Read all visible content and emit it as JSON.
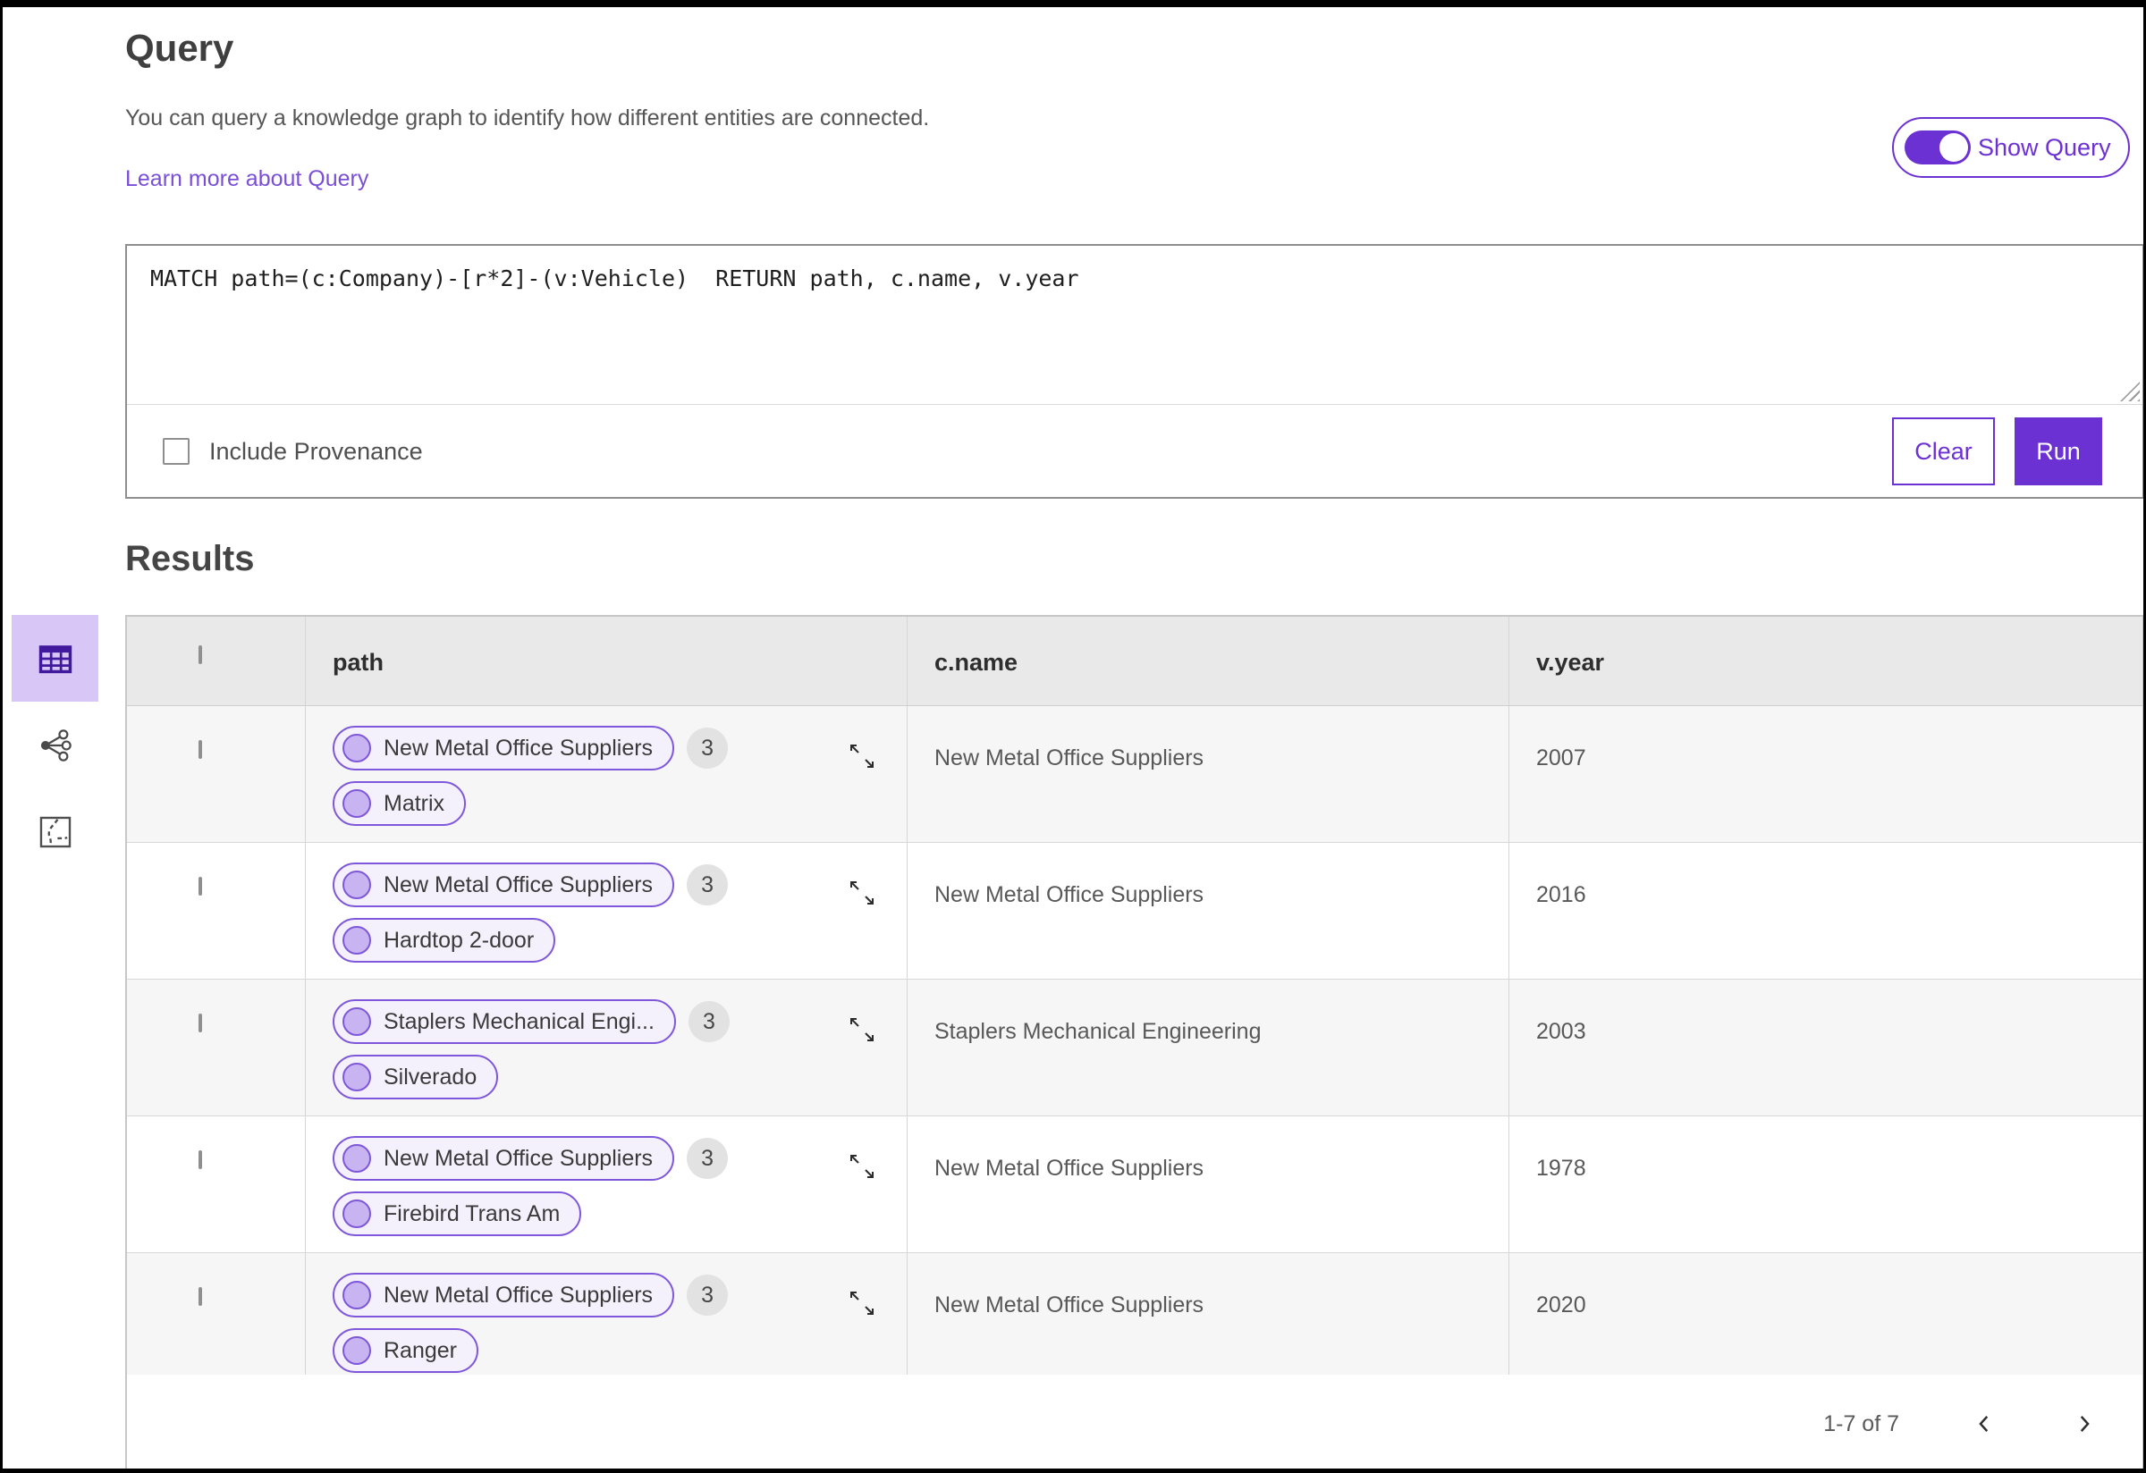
{
  "header": {
    "title": "Query",
    "description": "You can query a knowledge graph to identify how different entities are connected.",
    "learn_more_link": "Learn more about Query",
    "show_query_label": "Show Query"
  },
  "query_panel": {
    "query_text": "MATCH path=(c:Company)-[r*2]-(v:Vehicle)  RETURN path, c.name, v.year",
    "include_provenance_label": "Include Provenance",
    "clear_button": "Clear",
    "run_button": "Run"
  },
  "results": {
    "title": "Results",
    "views": [
      "table-view",
      "graph-view",
      "map-view"
    ],
    "selected_view": "table-view"
  },
  "table": {
    "columns": [
      "path",
      "c.name",
      "v.year"
    ],
    "rows": [
      {
        "path_start": "New Metal Office Suppliers",
        "count": "3",
        "path_end": "Matrix",
        "c_name": "New Metal Office Suppliers",
        "v_year": "2007"
      },
      {
        "path_start": "New Metal Office Suppliers",
        "count": "3",
        "path_end": "Hardtop 2-door",
        "c_name": "New Metal Office Suppliers",
        "v_year": "2016"
      },
      {
        "path_start": "Staplers Mechanical Engi...",
        "count": "3",
        "path_end": "Silverado",
        "c_name": "Staplers Mechanical Engineering",
        "v_year": "2003"
      },
      {
        "path_start": "New Metal Office Suppliers",
        "count": "3",
        "path_end": "Firebird Trans Am",
        "c_name": "New Metal Office Suppliers",
        "v_year": "1978"
      },
      {
        "path_start": "New Metal Office Suppliers",
        "count": "3",
        "path_end": "Ranger",
        "c_name": "New Metal Office Suppliers",
        "v_year": "2020"
      }
    ],
    "pagination": {
      "range": "1-7 of 7"
    }
  },
  "colors": {
    "accent_purple": "#6c31d3",
    "link_purple": "#7a4fd8",
    "pill_border": "#7e57da",
    "pill_bg": "#f4f1fc",
    "node_fill": "#c8b4f0",
    "selected_view_bg": "#d8c6f6",
    "selected_icon": "#40199c"
  }
}
